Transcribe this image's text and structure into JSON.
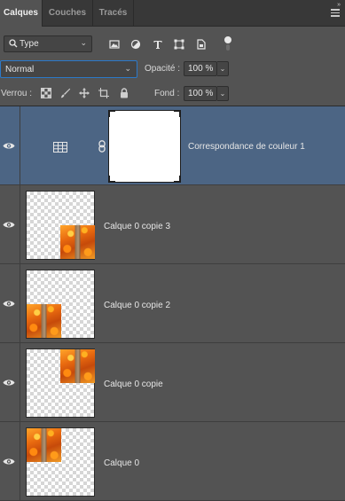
{
  "tabs": [
    {
      "label": "Calques",
      "active": true
    },
    {
      "label": "Couches",
      "active": false
    },
    {
      "label": "Tracés",
      "active": false
    }
  ],
  "filter": {
    "kind_label": "Type",
    "icons": [
      "image-filter-icon",
      "adjustment-filter-icon",
      "text-filter-icon",
      "shape-filter-icon",
      "smart-object-filter-icon"
    ]
  },
  "blend": {
    "mode": "Normal",
    "opacity_label": "Opacité :",
    "opacity_value": "100 %",
    "fill_label": "Fond :",
    "fill_value": "100 %"
  },
  "lock": {
    "label": "Verrou :",
    "icons": [
      "lock-transparency-icon",
      "lock-pixels-icon",
      "lock-position-icon",
      "lock-artboard-icon",
      "lock-all-icon"
    ]
  },
  "layers": [
    {
      "name": "Correspondance de couleur 1",
      "type": "adjustment",
      "selected": true,
      "visible": true
    },
    {
      "name": "Calque 0 copie 3",
      "type": "pixel",
      "selected": false,
      "visible": true,
      "image_position": "bottom-right"
    },
    {
      "name": "Calque 0 copie 2",
      "type": "pixel",
      "selected": false,
      "visible": true,
      "image_position": "bottom-left"
    },
    {
      "name": "Calque 0 copie",
      "type": "pixel",
      "selected": false,
      "visible": true,
      "image_position": "top-right"
    },
    {
      "name": "Calque 0",
      "type": "pixel",
      "selected": false,
      "visible": true,
      "image_position": "top-left"
    }
  ],
  "colors": {
    "panel": "#535353",
    "selected": "#4c6584",
    "focus": "#2b79c9"
  }
}
